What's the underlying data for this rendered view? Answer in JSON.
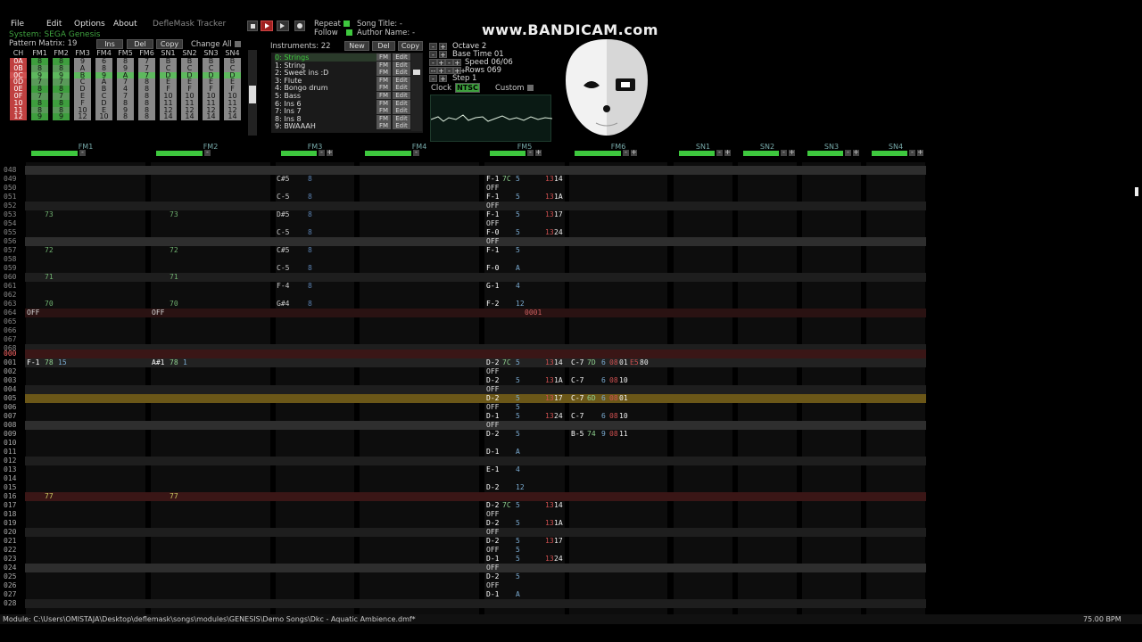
{
  "menu": [
    "File",
    "Edit",
    "Options",
    "About",
    "DefleMask Tracker"
  ],
  "system_label": "System: SEGA Genesis",
  "transport": {
    "repeat": "Repeat",
    "follow": "Follow",
    "song_title": "Song Title: -",
    "author_name": "Author Name: -"
  },
  "watermark": "www.BANDICAM.com",
  "matrix": {
    "label": "Pattern Matrix: 19",
    "ins": "Ins",
    "del": "Del",
    "copy": "Copy",
    "change_all": "Change All",
    "headers": [
      "CH",
      "FM1",
      "FM2",
      "FM3",
      "FM4",
      "FM5",
      "FM6",
      "SN1",
      "SN2",
      "SN3",
      "SN4"
    ],
    "rows": [
      [
        "0A",
        "8",
        "8",
        "9",
        "6",
        "8",
        "7",
        "B",
        "B",
        "B",
        "B"
      ],
      [
        "0B",
        "8",
        "8",
        "A",
        "8",
        "9",
        "7",
        "C",
        "C",
        "C",
        "C"
      ],
      [
        "0C",
        "9",
        "9",
        "B",
        "9",
        "A",
        "7",
        "D",
        "D",
        "D",
        "D"
      ],
      [
        "0D",
        "7",
        "7",
        "C",
        "A",
        "7",
        "8",
        "E",
        "E",
        "E",
        "E"
      ],
      [
        "0E",
        "8",
        "8",
        "D",
        "B",
        "4",
        "8",
        "F",
        "F",
        "F",
        "F"
      ],
      [
        "0F",
        "7",
        "7",
        "E",
        "C",
        "7",
        "8",
        "10",
        "10",
        "10",
        "10"
      ],
      [
        "10",
        "8",
        "8",
        "F",
        "D",
        "8",
        "8",
        "11",
        "11",
        "11",
        "11"
      ],
      [
        "11",
        "8",
        "8",
        "10",
        "E",
        "9",
        "8",
        "12",
        "12",
        "12",
        "12"
      ],
      [
        "12",
        "9",
        "9",
        "12",
        "10",
        "8",
        "8",
        "14",
        "14",
        "14",
        "14"
      ]
    ]
  },
  "instruments": {
    "label": "Instruments: 22",
    "new": "New",
    "del": "Del",
    "copy": "Copy",
    "fm": "FM",
    "edit": "Edit",
    "items": [
      "0: Strings",
      "1: String",
      "2: Sweet ins :D",
      "3: Flute",
      "4: Bongo drum",
      "5: Bass",
      "6: Ins 6",
      "7: Ins 7",
      "8: Ins 8",
      "9: BWAAAH"
    ]
  },
  "settings": {
    "octave": "Octave 2",
    "base_time": "Base Time 01",
    "speed": "Speed 06/06",
    "rows": "Rows 069",
    "step": "Step 1",
    "clock": "Clock",
    "ntsc": "NTSC",
    "custom": "Custom",
    "minus": "-",
    "plus": "+",
    "minusminus": "--",
    "plusplus": "++"
  },
  "channels": [
    "FM1",
    "FM2",
    "FM3",
    "FM4",
    "FM5",
    "FM6",
    "SN1",
    "SN2",
    "SN3",
    "SN4"
  ],
  "row_numbers_top": [
    "048",
    "049",
    "050",
    "051",
    "052",
    "053",
    "054",
    "055",
    "056",
    "057",
    "058",
    "059",
    "060",
    "061",
    "062",
    "063",
    "064",
    "065",
    "066",
    "067",
    "068"
  ],
  "row_numbers_bottom": [
    "000",
    "001",
    "002",
    "003",
    "004",
    "005",
    "006",
    "007",
    "008",
    "009",
    "010",
    "011",
    "012",
    "013",
    "014",
    "015",
    "016",
    "017",
    "018",
    "019",
    "020",
    "021",
    "022",
    "023",
    "024",
    "025",
    "026",
    "027",
    "028"
  ],
  "cells": {
    "fm1": {
      "r053": "73",
      "r057": "72",
      "r060": "71",
      "r063": "70",
      "r064": "OFF",
      "r001": "F-1",
      "r001i": "78",
      "r001v": "15",
      "r016": "77"
    },
    "fm2": {
      "r053": "73",
      "r057": "72",
      "r060": "71",
      "r063": "70",
      "r064": "OFF",
      "r001": "A#1",
      "r001i": "78",
      "r001v": "1",
      "r016": "77"
    },
    "fm3": {
      "r049": "C#5",
      "r051": "C-5",
      "r053": "D#5",
      "r055": "C-5",
      "r057": "C#5",
      "r059": "C-5",
      "r061": "F-4",
      "r063": "G#4",
      "v": "8"
    },
    "fm5": {
      "top": [
        [
          "049",
          "F-1",
          "7C",
          "5",
          "13",
          "14"
        ],
        [
          "050",
          "OFF",
          "",
          "",
          "",
          ""
        ],
        [
          "051",
          "F-1",
          "",
          "5",
          "13",
          "1A"
        ],
        [
          "052",
          "OFF",
          "",
          "",
          "",
          ""
        ],
        [
          "053",
          "F-1",
          "",
          "5",
          "13",
          "17"
        ],
        [
          "054",
          "OFF",
          "",
          "",
          "",
          ""
        ],
        [
          "055",
          "F-0",
          "",
          "5",
          "13",
          "24"
        ],
        [
          "056",
          "OFF",
          "",
          "",
          "",
          ""
        ],
        [
          "057",
          "F-1",
          "",
          "5",
          "",
          ""
        ],
        [
          "059",
          "F-0",
          "",
          "A",
          "",
          ""
        ],
        [
          "061",
          "G-1",
          "",
          "4",
          "",
          ""
        ],
        [
          "063",
          "F-2",
          "",
          "12",
          "",
          ""
        ]
      ],
      "r064fx": "0001",
      "bottom": [
        [
          "001",
          "D-2",
          "7C",
          "5",
          "13",
          "14"
        ],
        [
          "002",
          "OFF",
          "",
          "",
          "",
          ""
        ],
        [
          "003",
          "D-2",
          "",
          "5",
          "13",
          "1A"
        ],
        [
          "004",
          "OFF",
          "",
          "",
          "",
          ""
        ],
        [
          "005",
          "D-2",
          "",
          "5",
          "13",
          "17"
        ],
        [
          "006",
          "OFF",
          "",
          "5",
          "",
          ""
        ],
        [
          "007",
          "D-1",
          "",
          "5",
          "13",
          "24"
        ],
        [
          "008",
          "OFF",
          "",
          "",
          "",
          ""
        ],
        [
          "009",
          "D-2",
          "",
          "5",
          "",
          ""
        ],
        [
          "011",
          "D-1",
          "",
          "A",
          "",
          ""
        ],
        [
          "013",
          "E-1",
          "",
          "4",
          "",
          ""
        ],
        [
          "015",
          "D-2",
          "",
          "12",
          "",
          ""
        ],
        [
          "017",
          "D-2",
          "7C",
          "5",
          "13",
          "14"
        ],
        [
          "018",
          "OFF",
          "",
          "",
          "",
          ""
        ],
        [
          "019",
          "D-2",
          "",
          "5",
          "13",
          "1A"
        ],
        [
          "020",
          "OFF",
          "",
          "",
          "",
          ""
        ],
        [
          "021",
          "D-2",
          "",
          "5",
          "13",
          "17"
        ],
        [
          "022",
          "OFF",
          "",
          "5",
          "",
          ""
        ],
        [
          "023",
          "D-1",
          "",
          "5",
          "13",
          "24"
        ],
        [
          "024",
          "OFF",
          "",
          "",
          "",
          ""
        ],
        [
          "025",
          "D-2",
          "",
          "5",
          "",
          ""
        ],
        [
          "026",
          "OFF",
          "",
          "",
          "",
          ""
        ],
        [
          "027",
          "D-1",
          "",
          "A",
          "",
          ""
        ]
      ]
    },
    "fm6": [
      [
        "001",
        "C-7",
        "7D",
        "6",
        "08",
        "01",
        "E5",
        "80"
      ],
      [
        "003",
        "C-7",
        "",
        "6",
        "08",
        "10",
        "",
        ""
      ],
      [
        "005",
        "C-7",
        "6D",
        "6",
        "08",
        "01",
        "",
        ""
      ],
      [
        "007",
        "C-7",
        "",
        "6",
        "08",
        "10",
        "",
        ""
      ],
      [
        "009",
        "B-5",
        "74",
        "9",
        "08",
        "11",
        "",
        ""
      ]
    ]
  },
  "status": {
    "module": "Module: C:\\Users\\OMISTAJA\\Desktop\\deflemask\\songs\\modules\\GENESIS\\Demo Songs\\Dkc - Aquatic Ambience.dmf*",
    "bpm": "75.00 BPM"
  },
  "colors": {
    "green": "#3ec83e",
    "orange": "#a07020",
    "red": "#702020",
    "accent": "#8fd08f"
  }
}
